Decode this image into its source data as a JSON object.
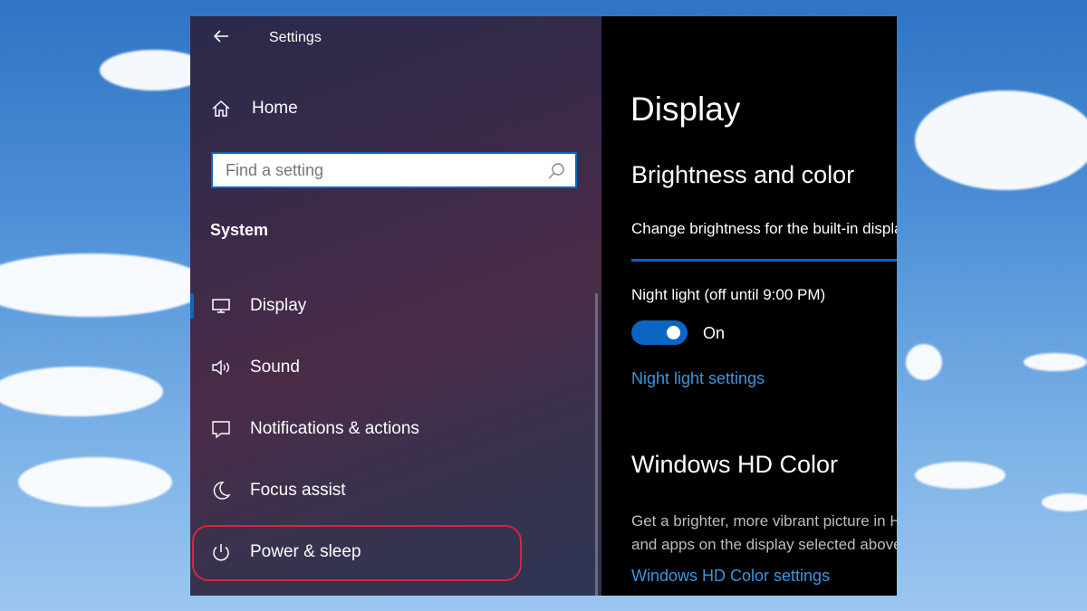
{
  "window": {
    "title": "Settings"
  },
  "sidebar": {
    "home_label": "Home",
    "search_placeholder": "Find a setting",
    "section": "System",
    "items": [
      {
        "label": "Display",
        "icon": "monitor-icon",
        "active": true
      },
      {
        "label": "Sound",
        "icon": "speaker-icon"
      },
      {
        "label": "Notifications & actions",
        "icon": "message-icon"
      },
      {
        "label": "Focus assist",
        "icon": "moon-icon"
      },
      {
        "label": "Power & sleep",
        "icon": "power-icon",
        "highlighted": true
      }
    ]
  },
  "content": {
    "page_title": "Display",
    "brightness_heading": "Brightness and color",
    "brightness_label": "Change brightness for the built-in display",
    "night_light_label": "Night light (off until 9:00 PM)",
    "night_light_state": "On",
    "night_light_link": "Night light settings",
    "hd_heading": "Windows HD Color",
    "hd_desc_line1": "Get a brighter, more vibrant picture in HDR",
    "hd_desc_line2": "and apps on the display selected above.",
    "hd_link": "Windows HD Color settings"
  },
  "colors": {
    "accent": "#0a66c2",
    "link": "#3a96dd",
    "highlight_ring": "#d7263d"
  }
}
